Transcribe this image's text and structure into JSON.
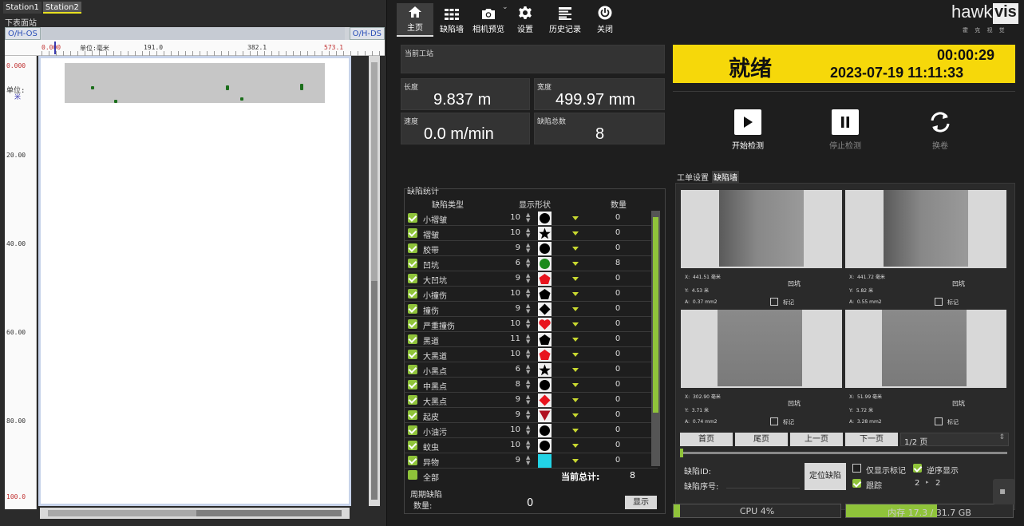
{
  "left": {
    "tabs": [
      "Station1",
      "Station2"
    ],
    "section": "下表面站",
    "os_label": "O/H-OS",
    "ds_label": "O/H-DS",
    "ruler": {
      "start": "0.000",
      "unit": "单位:毫米",
      "t1": "191.0",
      "t2": "382.1",
      "t3": "573.1"
    },
    "yaxis": {
      "top": "0.000",
      "unit_label": "单位:",
      "unit": "米",
      "ticks": [
        "20.00",
        "40.00",
        "60.00",
        "80.00",
        "100.0"
      ]
    }
  },
  "nav": [
    {
      "label": "主页",
      "icon": "home-icon"
    },
    {
      "label": "缺陷墙",
      "icon": "grid-icon"
    },
    {
      "label": "相机预览",
      "icon": "camera-icon"
    },
    {
      "label": "设置",
      "icon": "gear-icon"
    },
    {
      "label": "历史记录",
      "icon": "history-icon"
    },
    {
      "label": "关闭",
      "icon": "power-icon"
    }
  ],
  "info": {
    "station_label": "当前工站",
    "length_label": "长度",
    "length": "9.837 m",
    "width_label": "宽度",
    "width": "499.97 mm",
    "speed_label": "速度",
    "speed": "0.0 m/min",
    "total_label": "缺陷总数",
    "total": "8"
  },
  "stats": {
    "title": "缺陷统计",
    "headers": [
      "缺陷类型",
      "显示形状",
      "数量"
    ],
    "rows": [
      {
        "name": "小褶皱",
        "size": "10",
        "shape": "circle",
        "color": "#000000",
        "count": "0"
      },
      {
        "name": "褶皱",
        "size": "10",
        "shape": "star",
        "color": "#000000",
        "count": "0"
      },
      {
        "name": "胶带",
        "size": "9",
        "shape": "circle",
        "color": "#000000",
        "count": "0"
      },
      {
        "name": "凹坑",
        "size": "6",
        "shape": "circle",
        "color": "#1a8a1a",
        "count": "8"
      },
      {
        "name": "大凹坑",
        "size": "9",
        "shape": "pentagon",
        "color": "#e8141e",
        "count": "0"
      },
      {
        "name": "小撞伤",
        "size": "10",
        "shape": "pentagon",
        "color": "#000000",
        "count": "0"
      },
      {
        "name": "撞伤",
        "size": "9",
        "shape": "diamond",
        "color": "#000000",
        "count": "0"
      },
      {
        "name": "严重撞伤",
        "size": "10",
        "shape": "heart",
        "color": "#e8141e",
        "count": "0"
      },
      {
        "name": "黑道",
        "size": "11",
        "shape": "pentagon",
        "color": "#000000",
        "count": "0"
      },
      {
        "name": "大黑道",
        "size": "10",
        "shape": "pentagon",
        "color": "#e8141e",
        "count": "0"
      },
      {
        "name": "小黑点",
        "size": "6",
        "shape": "star",
        "color": "#000000",
        "count": "0"
      },
      {
        "name": "中黑点",
        "size": "8",
        "shape": "circle",
        "color": "#000000",
        "count": "0"
      },
      {
        "name": "大黑点",
        "size": "9",
        "shape": "diamond",
        "color": "#e8141e",
        "count": "0"
      },
      {
        "name": "起皮",
        "size": "9",
        "shape": "triangle",
        "color": "#b01020",
        "count": "0"
      },
      {
        "name": "小油污",
        "size": "10",
        "shape": "circle",
        "color": "#000000",
        "count": "0"
      },
      {
        "name": "蚊虫",
        "size": "10",
        "shape": "circle",
        "color": "#000000",
        "count": "0"
      },
      {
        "name": "异物",
        "size": "9",
        "shape": "square",
        "color": "#22d3e6",
        "count": "0"
      }
    ],
    "all_label": "全部",
    "current_total_label": "当前总计:",
    "current_total": "8",
    "cycle_label": "周期缺陷",
    "count_label": "数量:",
    "count": "0",
    "show_label": "显示"
  },
  "status": {
    "state": "就绪",
    "timer": "00:00:29",
    "datetime": "2023-07-19 11:11:33"
  },
  "controls": {
    "start": "开始检测",
    "stop": "停止检测",
    "change": "换卷"
  },
  "logo": {
    "text_a": "hawk",
    "text_b": "vis",
    "sub": "霍 克 视 觉"
  },
  "wall": {
    "tabs": [
      "工单设置",
      "缺陷墙"
    ],
    "cards": [
      {
        "x": "441.51 毫米",
        "y": "4.53 米",
        "a": "0.37 mm2",
        "type": "凹坑",
        "mark": "标记"
      },
      {
        "x": "441.72 毫米",
        "y": "5.82 米",
        "a": "0.55 mm2",
        "type": "凹坑",
        "mark": "标记"
      },
      {
        "x": "302.90 毫米",
        "y": "3.71 米",
        "a": "0.74 mm2",
        "type": "凹坑",
        "mark": "标记"
      },
      {
        "x": "51.99 毫米",
        "y": "3.72 米",
        "a": "3.28 mm2",
        "type": "凹坑",
        "mark": "标记"
      }
    ],
    "pager": {
      "first": "首页",
      "last": "尾页",
      "prev": "上一页",
      "next": "下一页",
      "page": "1/2 页"
    },
    "defect_id_label": "缺陷ID:",
    "defect_seq_label": "缺陷序号:",
    "locate": "定位缺陷",
    "only_marked": "仅显示标记",
    "reverse": "逆序显示",
    "follow": "跟踪",
    "follow_a": "2",
    "follow_b": "2"
  },
  "footer": {
    "cpu": "CPU 4%",
    "cpu_frac": 0.04,
    "mem": "内存 17.3 / 31.7 GB",
    "mem_frac": 0.546
  }
}
